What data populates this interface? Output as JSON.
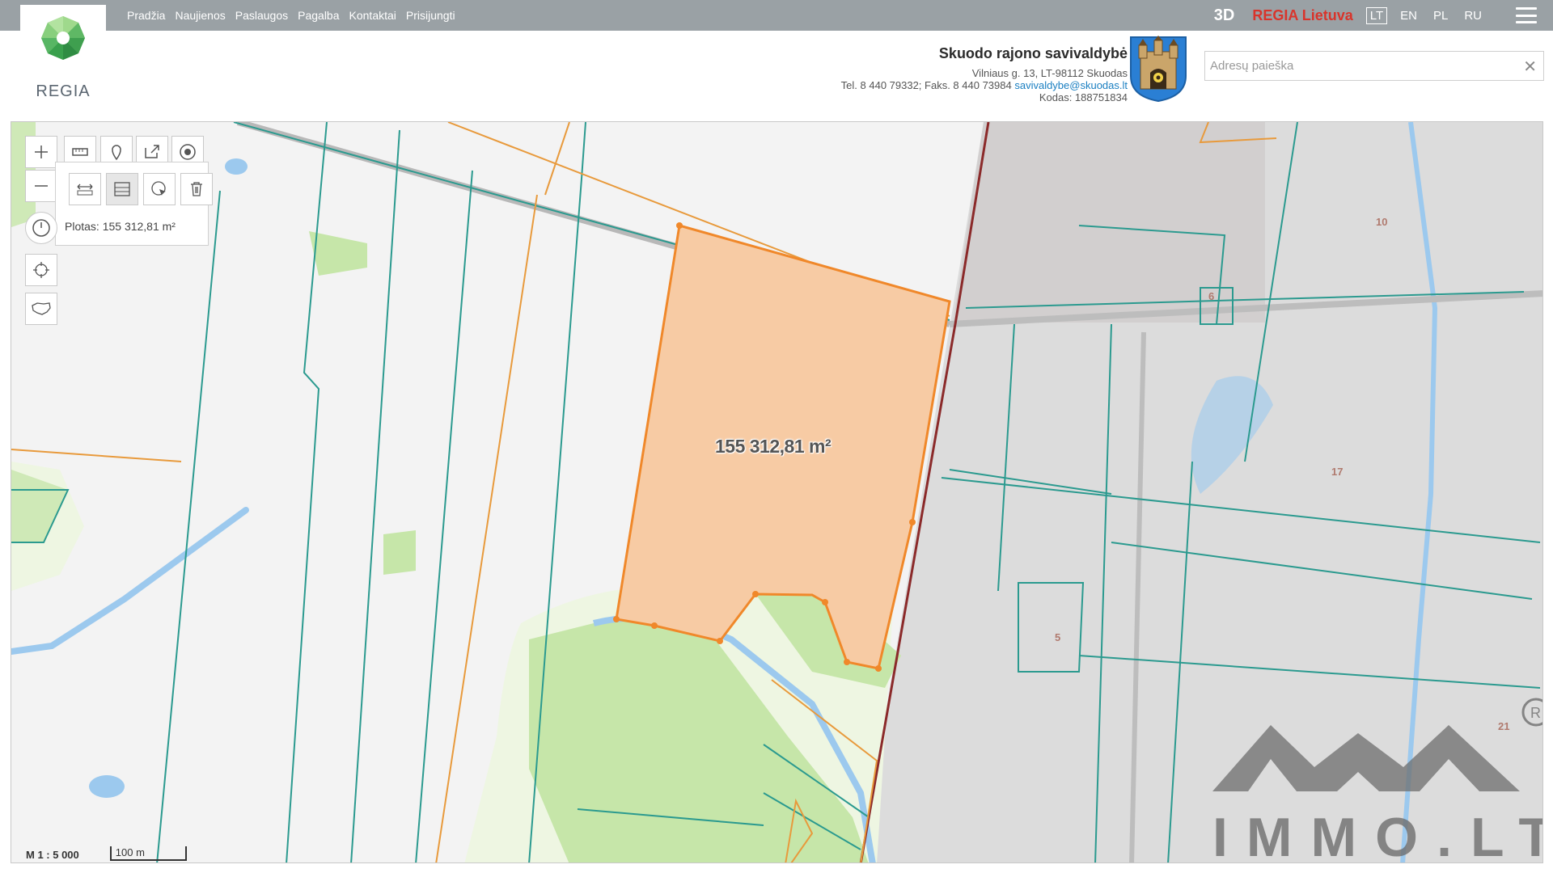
{
  "nav": {
    "items": [
      "Pradžia",
      "Naujienos",
      "Paslaugos",
      "Pagalba",
      "Kontaktai",
      "Prisijungti"
    ]
  },
  "brand": {
    "logo_text": "REGIA"
  },
  "topright": {
    "btn_3d": "3D",
    "regia_lietuva": "REGIA Lietuva",
    "languages": [
      "LT",
      "EN",
      "PL",
      "RU"
    ],
    "active_language": "LT"
  },
  "municipality": {
    "name": "Skuodo rajono savivaldybė",
    "address": "Vilniaus g. 13, LT-98112 Skuodas",
    "phone_fax": "Tel. 8 440 79332; Faks. 8 440 73984",
    "email": "savivaldybe@skuodas.lt",
    "code": "Kodas: 188751834"
  },
  "search": {
    "placeholder": "Adresų paieška",
    "value": ""
  },
  "measure": {
    "readout": "Plotas: 155 312,81 m²",
    "map_label": "155 312,81 m²"
  },
  "scale": {
    "ratio": "M 1 : 5 000",
    "bar_label": "100 m"
  },
  "parcel_numbers": [
    "10",
    "6",
    "17",
    "5",
    "21"
  ],
  "watermark": {
    "text": "IMMO.LT"
  },
  "colors": {
    "topbar": "#9aa1a5",
    "highlight_fill": "#f7cba4",
    "highlight_stroke": "#f0882a",
    "parcel_teal": "#2b9a8f",
    "parcel_orange": "#e89a3c",
    "boundary_dark": "#8b2a2a",
    "forest": "#c6e6a9",
    "water": "#9cc9ee",
    "brand_red": "#d9342b"
  },
  "icons": [
    "zoom-in-icon",
    "zoom-out-icon",
    "measure-line-icon",
    "pin-icon",
    "export-icon",
    "target-icon",
    "measure-distance-icon",
    "measure-area-icon",
    "select-icon",
    "trash-icon",
    "clock-icon",
    "locate-icon",
    "lithuania-outline-icon",
    "menu-icon",
    "clear-icon",
    "coat-of-arms-icon"
  ]
}
